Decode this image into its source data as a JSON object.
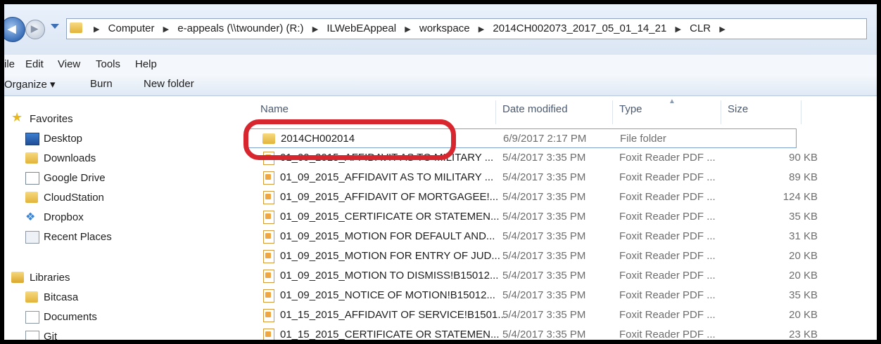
{
  "address": {
    "crumbs": [
      "Computer",
      "e-appeals (\\\\twounder) (R:)",
      "ILWebEAppeal",
      "workspace",
      "2014CH002073_2017_05_01_14_21",
      "CLR"
    ]
  },
  "menu": {
    "file": "ile",
    "edit": "Edit",
    "view": "View",
    "tools": "Tools",
    "help": "Help"
  },
  "commands": {
    "organize": "Organize ▾",
    "burn": "Burn",
    "new_folder": "New folder"
  },
  "nav": {
    "favorites": "Favorites",
    "desktop": "Desktop",
    "downloads": "Downloads",
    "google_drive": "Google Drive",
    "cloudstation": "CloudStation",
    "dropbox": "Dropbox",
    "recent": "Recent Places",
    "libraries": "Libraries",
    "bitcasa": "Bitcasa",
    "documents": "Documents",
    "git": "Git"
  },
  "columns": {
    "name": "Name",
    "date": "Date modified",
    "type": "Type",
    "size": "Size"
  },
  "files": [
    {
      "name": "2014CH002014",
      "date": "6/9/2017 2:17 PM",
      "type": "File folder",
      "size": ""
    },
    {
      "name": "01_09_2015_AFFIDAVIT AS TO MILITARY ...",
      "date": "5/4/2017 3:35 PM",
      "type": "Foxit Reader PDF ...",
      "size": "90 KB"
    },
    {
      "name": "01_09_2015_AFFIDAVIT AS TO MILITARY ...",
      "date": "5/4/2017 3:35 PM",
      "type": "Foxit Reader PDF ...",
      "size": "89 KB"
    },
    {
      "name": "01_09_2015_AFFIDAVIT OF MORTGAGEE!...",
      "date": "5/4/2017 3:35 PM",
      "type": "Foxit Reader PDF ...",
      "size": "124 KB"
    },
    {
      "name": "01_09_2015_CERTIFICATE OR STATEMEN...",
      "date": "5/4/2017 3:35 PM",
      "type": "Foxit Reader PDF ...",
      "size": "35 KB"
    },
    {
      "name": "01_09_2015_MOTION FOR DEFAULT AND...",
      "date": "5/4/2017 3:35 PM",
      "type": "Foxit Reader PDF ...",
      "size": "31 KB"
    },
    {
      "name": "01_09_2015_MOTION FOR ENTRY OF JUD...",
      "date": "5/4/2017 3:35 PM",
      "type": "Foxit Reader PDF ...",
      "size": "20 KB"
    },
    {
      "name": "01_09_2015_MOTION TO DISMISS!B15012...",
      "date": "5/4/2017 3:35 PM",
      "type": "Foxit Reader PDF ...",
      "size": "20 KB"
    },
    {
      "name": "01_09_2015_NOTICE OF MOTION!B15012...",
      "date": "5/4/2017 3:35 PM",
      "type": "Foxit Reader PDF ...",
      "size": "35 KB"
    },
    {
      "name": "01_15_2015_AFFIDAVIT OF SERVICE!B1501...",
      "date": "5/4/2017 3:35 PM",
      "type": "Foxit Reader PDF ...",
      "size": "20 KB"
    },
    {
      "name": "01_15_2015_CERTIFICATE OR STATEMEN...",
      "date": "5/4/2017 3:35 PM",
      "type": "Foxit Reader PDF ...",
      "size": "23 KB"
    }
  ],
  "colors": {
    "highlight": "#d8262e",
    "selection_border": "#7da2ce",
    "folder": "#e2b33a"
  }
}
